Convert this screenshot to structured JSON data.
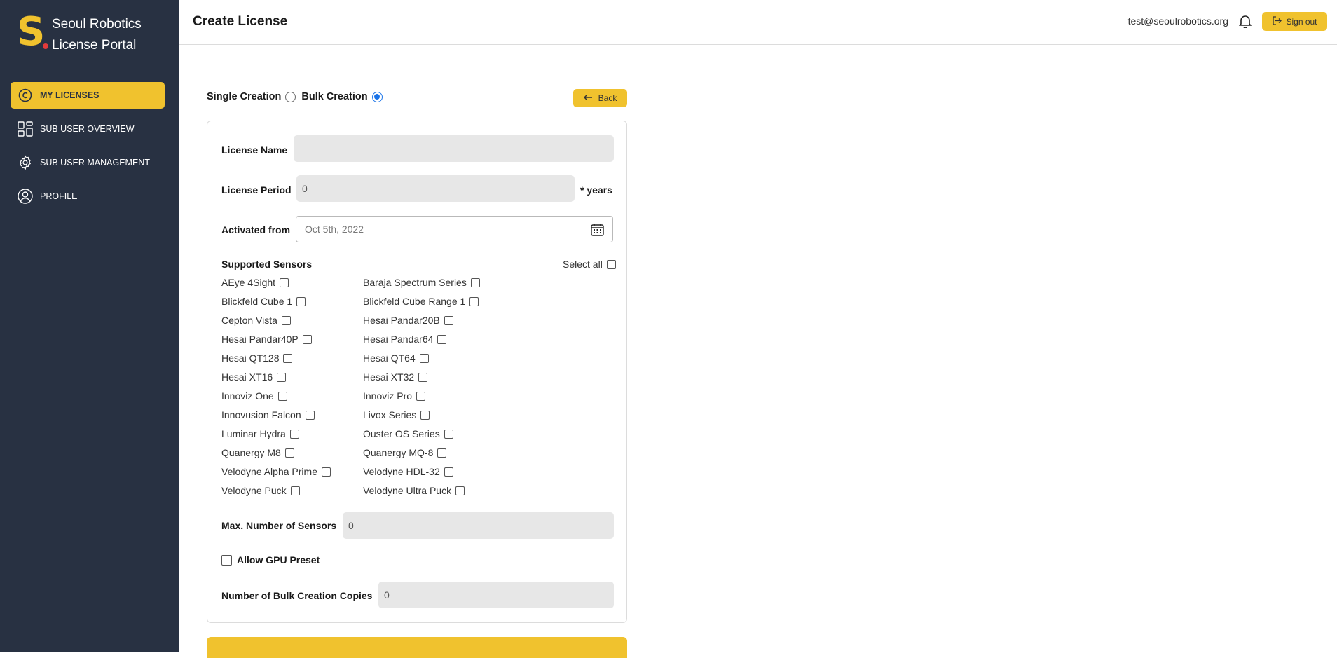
{
  "brand": {
    "line1": "Seoul Robotics",
    "line2": "License Portal",
    "logo_letter": "S"
  },
  "sidebar": {
    "items": [
      {
        "label": "MY LICENSES",
        "icon": "copyright-icon",
        "active": true
      },
      {
        "label": "SUB USER OVERVIEW",
        "icon": "grid-icon",
        "active": false
      },
      {
        "label": "SUB USER MANAGEMENT",
        "icon": "gear-icon",
        "active": false
      },
      {
        "label": "PROFILE",
        "icon": "user-circle-icon",
        "active": false
      }
    ]
  },
  "header": {
    "title": "Create License",
    "user_email": "test@seoulrobotics.org",
    "signout_label": "Sign out"
  },
  "mode": {
    "single_label": "Single Creation",
    "bulk_label": "Bulk Creation",
    "selected": "bulk",
    "back_label": "Back"
  },
  "form": {
    "license_name_label": "License Name",
    "license_name_value": "",
    "license_period_label": "License Period",
    "license_period_value": "0",
    "license_period_unit": "* years",
    "activated_from_label": "Activated from",
    "activated_from_value": "Oct 5th, 2022",
    "supported_sensors_label": "Supported Sensors",
    "select_all_label": "Select all",
    "sensors_left": [
      "AEye 4Sight",
      "Blickfeld Cube 1",
      "Cepton Vista",
      "Hesai Pandar40P",
      "Hesai QT128",
      "Hesai XT16",
      "Innoviz One",
      "Innovusion Falcon",
      "Luminar Hydra",
      "Quanergy M8",
      "Velodyne Alpha Prime",
      "Velodyne Puck"
    ],
    "sensors_right": [
      "Baraja Spectrum Series",
      "Blickfeld Cube Range 1",
      "Hesai Pandar20B",
      "Hesai Pandar64",
      "Hesai QT64",
      "Hesai XT32",
      "Innoviz Pro",
      "Livox Series",
      "Ouster OS Series",
      "Quanergy MQ-8",
      "Velodyne HDL-32",
      "Velodyne Ultra Puck"
    ],
    "max_sensors_label": "Max. Number of Sensors",
    "max_sensors_value": "0",
    "gpu_preset_label": "Allow GPU Preset",
    "bulk_copies_label": "Number of Bulk Creation Copies",
    "bulk_copies_value": "0"
  },
  "colors": {
    "sidebar_bg": "#283142",
    "accent": "#f0c22e",
    "radio_selected": "#1a73e8"
  }
}
